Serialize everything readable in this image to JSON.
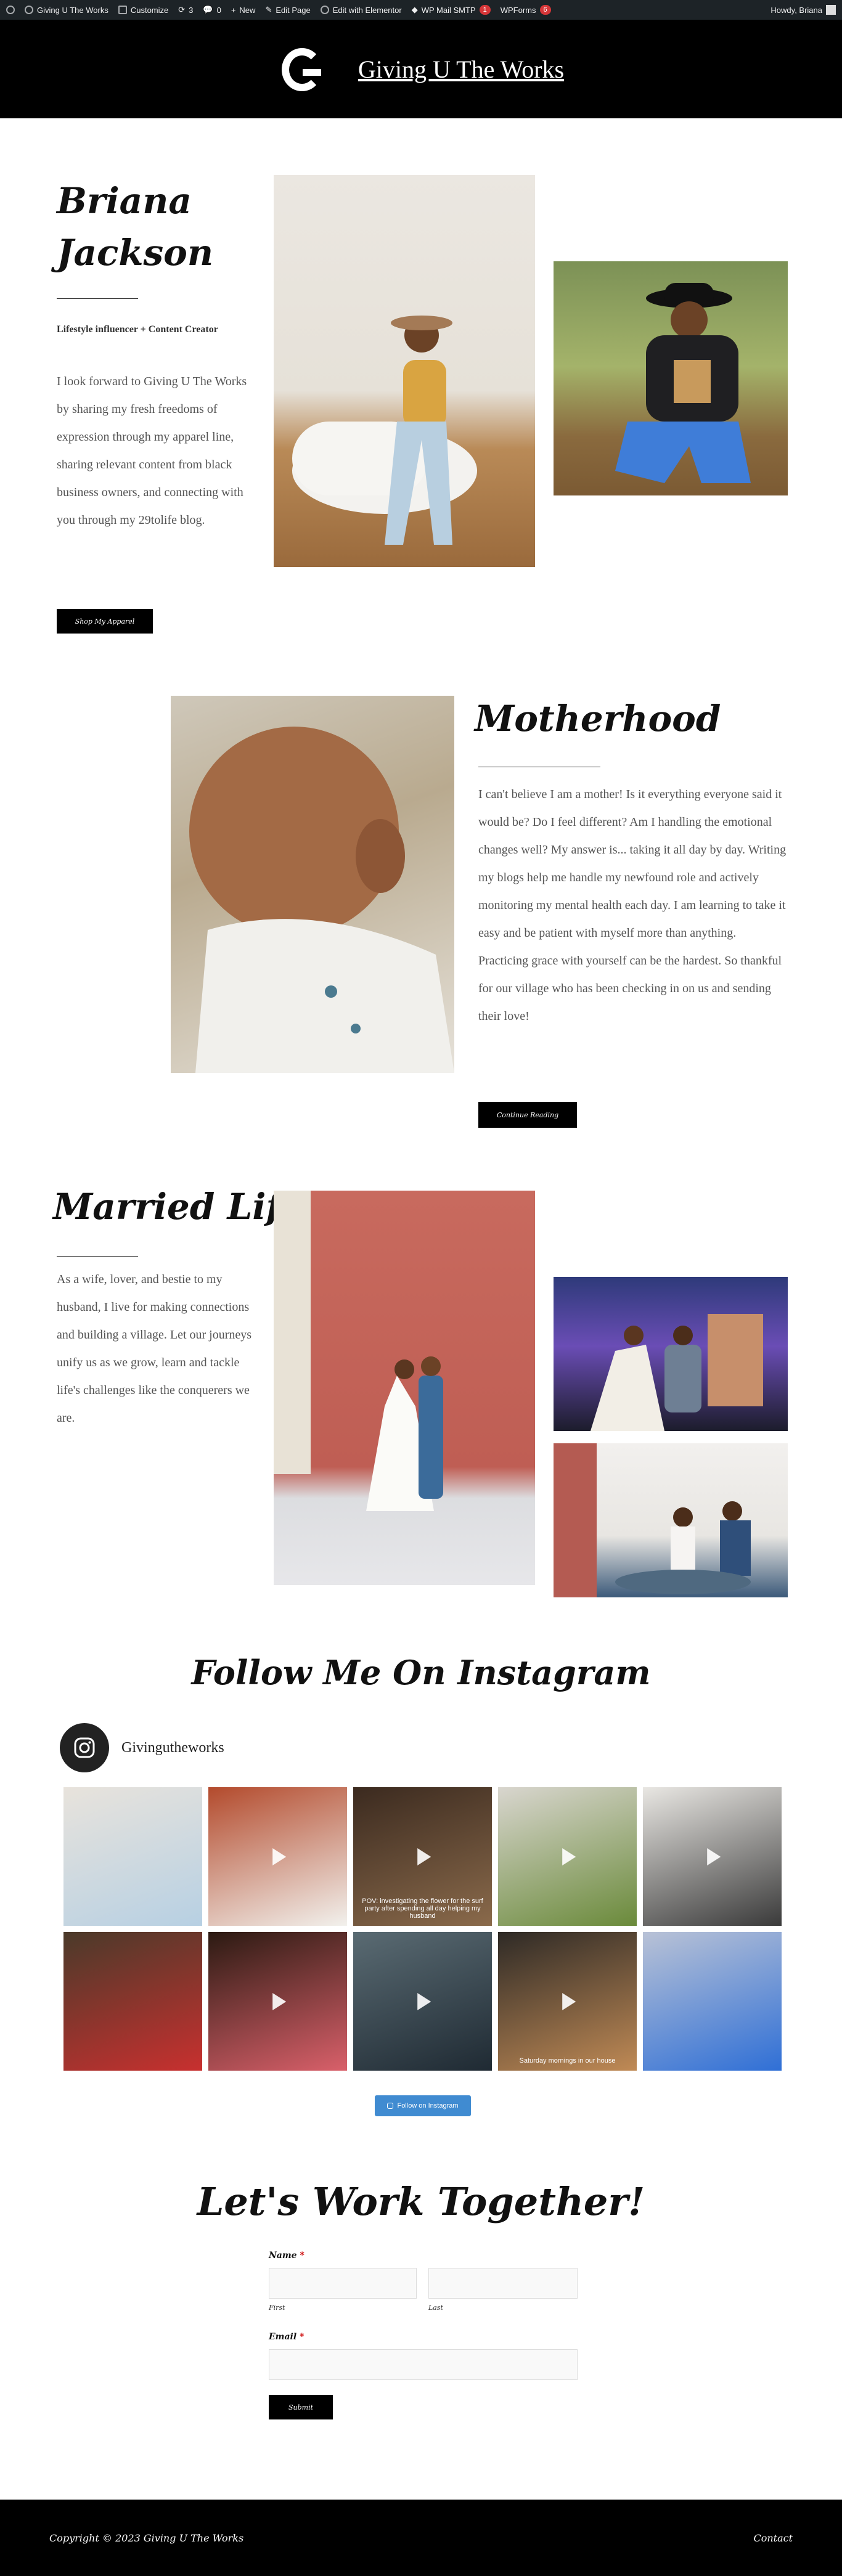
{
  "adminbar": {
    "site": "Giving U The Works",
    "customize": "Customize",
    "updates": "3",
    "comments": "0",
    "new": "New",
    "edit_page": "Edit Page",
    "elementor": "Edit with Elementor",
    "smtp": "WP Mail SMTP",
    "smtp_count": "1",
    "wpforms": "WPForms",
    "wpforms_count": "6",
    "howdy": "Howdy, Briana"
  },
  "header": {
    "site_title": "Giving U The Works"
  },
  "intro": {
    "name": "Briana Jackson",
    "tagline": "Lifestyle influencer + Content Creator",
    "body": "I look forward to Giving U The Works by sharing my fresh freedoms of expression through my apparel line, sharing relevant content from black business owners, and connecting with you through my 29tolife blog.",
    "button": "Shop My Apparel"
  },
  "motherhood": {
    "title": "Motherhood",
    "body": "I can't believe I am a mother! Is it everything everyone said it would be? Do I feel different? Am I handling the emotional changes well? My answer is... taking it all day by day. Writing my blogs help me handle my newfound role and actively monitoring my mental health each day. I am learning to take it easy and be patient with myself more than anything. Practicing grace with yourself can be the hardest. So thankful for our village who has been checking in on us and sending their love!",
    "button": "Continue Reading"
  },
  "married": {
    "title": "Married Life",
    "body": "As a wife, lover, and bestie to my husband, I live for making connections and building a village. Let our journeys unify us as we grow, learn and tackle life's challenges like the conquerers we are."
  },
  "instagram": {
    "title": "Follow Me On Instagram",
    "username": "Givingutheworks",
    "follow": "Follow on Instagram",
    "tiles": [
      {
        "caption": ""
      },
      {
        "caption": ""
      },
      {
        "caption": "POV: investigating the flower for the surf party after spending all day helping my husband"
      },
      {
        "caption": ""
      },
      {
        "caption": ""
      },
      {
        "caption": ""
      },
      {
        "caption": ""
      },
      {
        "caption": ""
      },
      {
        "caption": "Saturday mornings in our house"
      },
      {
        "caption": ""
      }
    ]
  },
  "contact": {
    "title": "Let's Work Together!",
    "name_label": "Name",
    "first": "First",
    "last": "Last",
    "email_label": "Email",
    "required": "*",
    "submit": "Submit"
  },
  "footer": {
    "copyright": "Copyright © 2023 Giving U The Works",
    "contact": "Contact"
  }
}
